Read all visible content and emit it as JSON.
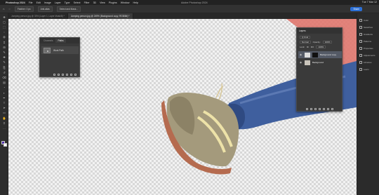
{
  "menubar": {
    "app_name": "Photoshop 2024",
    "items": [
      "File",
      "Edit",
      "Image",
      "Layer",
      "Type",
      "Select",
      "Filter",
      "3D",
      "View",
      "Plugins",
      "Window",
      "Help"
    ],
    "window_title": "Adobe Photoshop 2024",
    "clock": "Tue 7 Mar 12"
  },
  "options": {
    "feather": "Feather: 0 px",
    "anti_alias": "Anti-alias",
    "select_mask": "Select and Mask...",
    "share": "Share"
  },
  "tabs": [
    {
      "label": "Jumping person.jpg @ 33% (Layer 1, Layer Mask/8) *"
    },
    {
      "label": "Jumping person.jpg @ 249% (Background copy, RGB/8#) *"
    }
  ],
  "tools": [
    "move",
    "artboard",
    "marquee",
    "lasso",
    "quick-select",
    "crop",
    "frame",
    "eyedropper",
    "spot-heal",
    "brush",
    "clone-stamp",
    "history-brush",
    "eraser",
    "gradient",
    "blur",
    "dodge",
    "pen",
    "type",
    "path-select",
    "rectangle",
    "hand",
    "zoom",
    "more"
  ],
  "right_dock": [
    "Color",
    "Swatches",
    "Gradients",
    "Patterns",
    "Properties",
    "Adjustments",
    "Libraries",
    "Learn"
  ],
  "paths_panel": {
    "tabs": [
      "Channels",
      "Paths"
    ],
    "active_tab": "Paths",
    "path_name": "Work Path"
  },
  "layers_panel": {
    "title": "Layers",
    "kind_filter": "Q Kind",
    "blend_mode": "Normal",
    "opacity_label": "Opacity:",
    "opacity": "100%",
    "lock_label": "Lock:",
    "fill_label": "Fill:",
    "fill": "100%",
    "layers": [
      {
        "name": "Background copy",
        "visible": true,
        "active": true
      },
      {
        "name": "Background",
        "visible": true,
        "active": false
      }
    ]
  },
  "colors": {
    "accent": "#2b6fd6",
    "panel_bg": "#3a3a3a",
    "ui_bg": "#1e1e1e",
    "shoe_upper": "#a49a7c",
    "sole": "#b56b4f",
    "jeans": "#3f5f9e",
    "pink": "#e0776e"
  }
}
